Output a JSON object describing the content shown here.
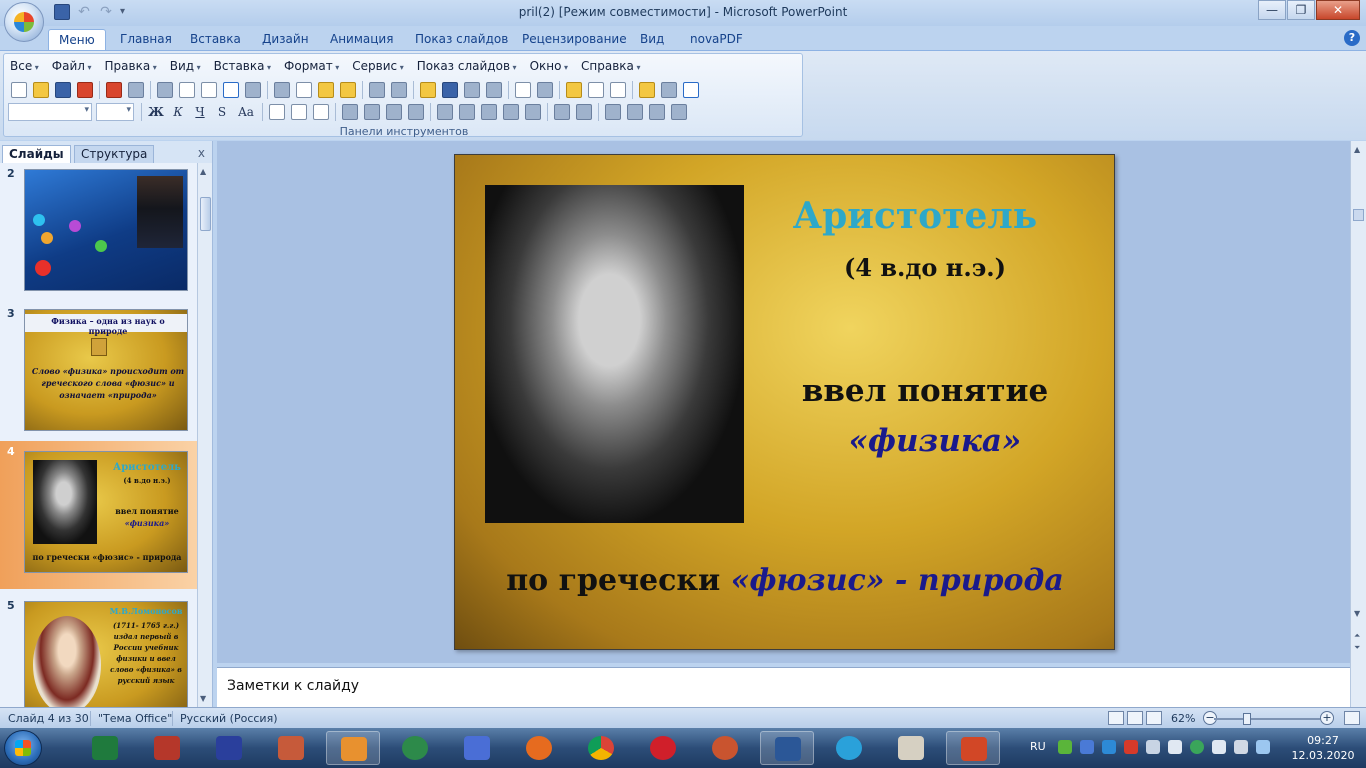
{
  "window": {
    "title": "pril(2) [Режим совместимости] - Microsoft PowerPoint",
    "controls": {
      "minimize": "—",
      "maximize": "❐",
      "close": "✕"
    }
  },
  "ribbon_tabs": [
    "Меню",
    "Главная",
    "Вставка",
    "Дизайн",
    "Анимация",
    "Показ слайдов",
    "Рецензирование",
    "Вид",
    "novaPDF"
  ],
  "active_tab": "Меню",
  "menu_bar": [
    "Все",
    "Файл",
    "Правка",
    "Вид",
    "Вставка",
    "Формат",
    "Сервис",
    "Показ слайдов",
    "Окно",
    "Справка"
  ],
  "toolbar": {
    "caption": "Панели инструментов",
    "format_buttons": {
      "bold": "Ж",
      "italic": "К",
      "underline": "Ч",
      "shadow": "S",
      "case": "Aa"
    }
  },
  "slides_pane": {
    "tab_slides": "Слайды",
    "tab_outline": "Структура",
    "close": "x",
    "thumbnails": [
      {
        "number": "2"
      },
      {
        "number": "3",
        "title": "Физика – одна из наук о природе",
        "body": "Слово «физика» происходит от греческого слова «фюзис» и означает «природа»"
      },
      {
        "number": "4",
        "title": "Аристотель",
        "sub": "(4 в.до н.э.)",
        "intro": "ввел понятие",
        "term": "«физика»",
        "bottom": "по гречески «фюзис» - природа"
      },
      {
        "number": "5",
        "title": "М.В.Ломоносов",
        "body": "(1711- 1765 г.г.) издал первый в России учебник физики и ввел слово «физика» в русский язык"
      }
    ]
  },
  "slide": {
    "title": "Аристотель",
    "subtitle": "(4 в.до н.э.)",
    "intro": "ввел понятие",
    "term": "«физика»",
    "bottom_prefix": "по гречески ",
    "bottom_term": "«фюзис» - природа"
  },
  "notes": {
    "placeholder": "Заметки к слайду"
  },
  "status_bar": {
    "slide_counter": "Слайд 4 из 30",
    "theme": "\"Тема Office\"",
    "language": "Русский (Россия)",
    "zoom": "62%",
    "zoom_fraction": 0.31
  },
  "taskbar": {
    "language": "RU",
    "time": "09:27",
    "date": "12.03.2020"
  },
  "colors": {
    "slide_title": "#2ea8c9",
    "slide_term": "#1a1a8c",
    "ribbon_text": "#15428b"
  }
}
